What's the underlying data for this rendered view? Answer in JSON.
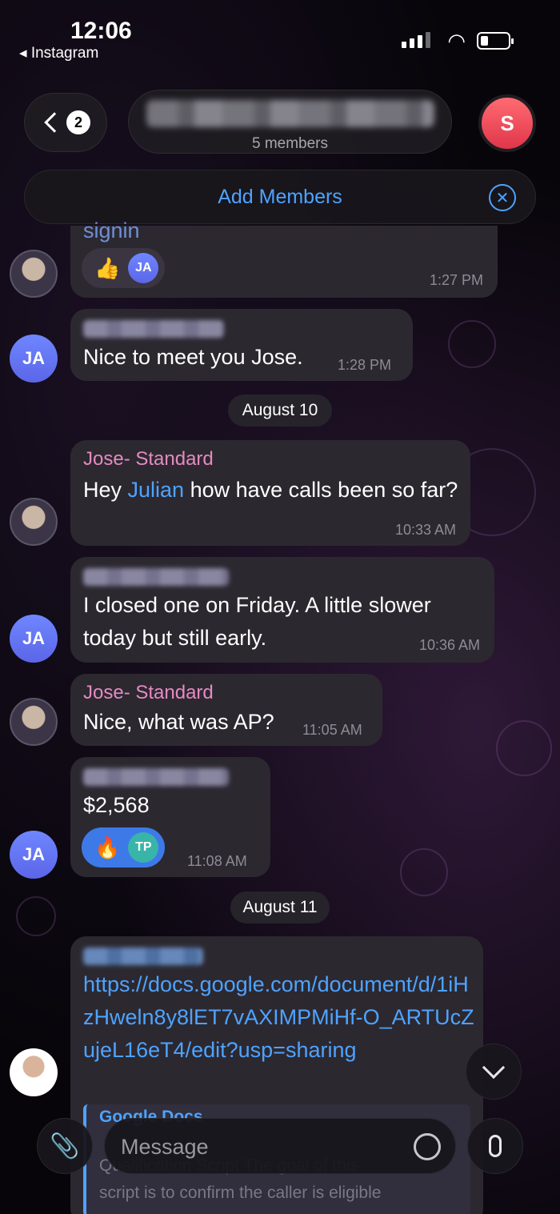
{
  "status_bar": {
    "time": "12:06",
    "back_app": "◂ Instagram"
  },
  "header": {
    "unread_count": "2",
    "subtitle": "5 members",
    "avatar_initial": "S",
    "add_members_label": "Add Members"
  },
  "messages": [
    {
      "partial_text": "signin",
      "reaction_emoji": "👍",
      "reaction_user": "JA",
      "time": "1:27 PM"
    },
    {
      "avatar": "JA",
      "text": "Nice to meet you Jose.",
      "time": "1:28 PM"
    },
    {
      "date": "August 10"
    },
    {
      "sender": "Jose- Standard",
      "text_before": "Hey ",
      "mention": "Julian",
      "text_after": " how have calls been so far?",
      "time": "10:33 AM"
    },
    {
      "avatar": "JA",
      "text": "I closed one on Friday. A little slower today but still early.",
      "time": "10:36 AM"
    },
    {
      "sender": "Jose- Standard",
      "text": "Nice, what was AP?",
      "time": "11:05 AM"
    },
    {
      "avatar": "JA",
      "text": "$2,568",
      "reaction_emoji": "🔥",
      "reaction_user": "TP",
      "time": "11:08 AM"
    },
    {
      "date": "August 11"
    },
    {
      "link": "https://docs.google.com/document/d/1iHzHweln8y8lET7vAXIMPMiHf-O_ARTUcZujeL16eT4/edit?usp=sharing",
      "preview_title": "Google Docs",
      "preview_lines": [
        "Qualification Script The goal of this",
        "script is to confirm the caller is eligible"
      ]
    }
  ],
  "footer": {
    "message_placeholder": "Message"
  },
  "colors": {
    "accent": "#4ea3ff",
    "sender": "#e58ac2",
    "bubble": "#2c2830"
  }
}
